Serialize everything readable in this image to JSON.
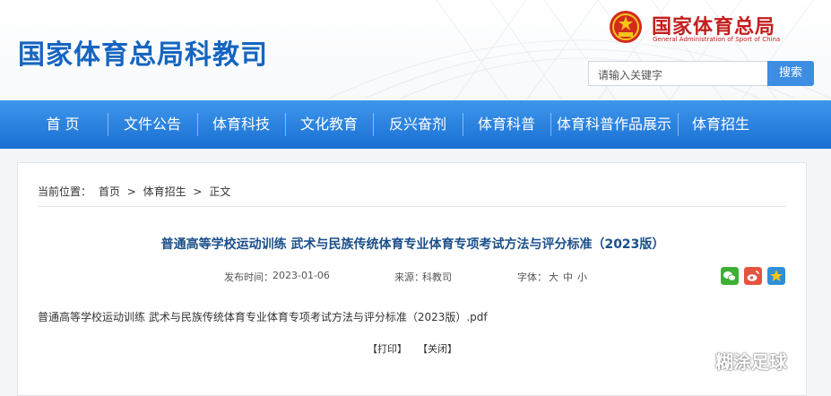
{
  "header": {
    "site_title": "国家体育总局科教司",
    "org_name_cn": "国家体育总局",
    "org_name_en": "General Administration of Sport of China",
    "emblem_icon": "national-emblem-icon"
  },
  "search": {
    "placeholder": "请输入关键字",
    "button_label": "搜索"
  },
  "nav": {
    "items": [
      {
        "label": "首 页"
      },
      {
        "label": "文件公告"
      },
      {
        "label": "体育科技"
      },
      {
        "label": "文化教育"
      },
      {
        "label": "反兴奋剂"
      },
      {
        "label": "体育科普"
      },
      {
        "label": "体育科普作品展示"
      },
      {
        "label": "体育招生"
      }
    ]
  },
  "breadcrumb": {
    "prefix": "当前位置：",
    "items": [
      "首页",
      ">",
      "体育招生",
      ">",
      "正文"
    ]
  },
  "article": {
    "title": "普通高等学校运动训练 武术与民族传统体育专业体育专项考试方法与评分标准（2023版）",
    "publish_label": "发布时间：",
    "publish_date": "2023-01-06",
    "source_label": "来源：",
    "source": "科教司",
    "font_label": "字体：",
    "font_sizes": [
      "大",
      "中",
      "小"
    ],
    "attachment": "普通高等学校运动训练 武术与民族传统体育专业体育专项考试方法与评分标准（2023版）.pdf",
    "print_label": "【打印】",
    "close_label": "【关闭】"
  },
  "share": {
    "icons": [
      "wechat-share-icon",
      "weibo-share-icon",
      "favorite-star-icon"
    ]
  },
  "watermark": {
    "text": "糊涂足球"
  },
  "colors": {
    "brand_blue": "#1565c0",
    "nav_blue": "#1a6fd2",
    "title_blue": "#1b4f8a",
    "red": "#c41d1d"
  }
}
